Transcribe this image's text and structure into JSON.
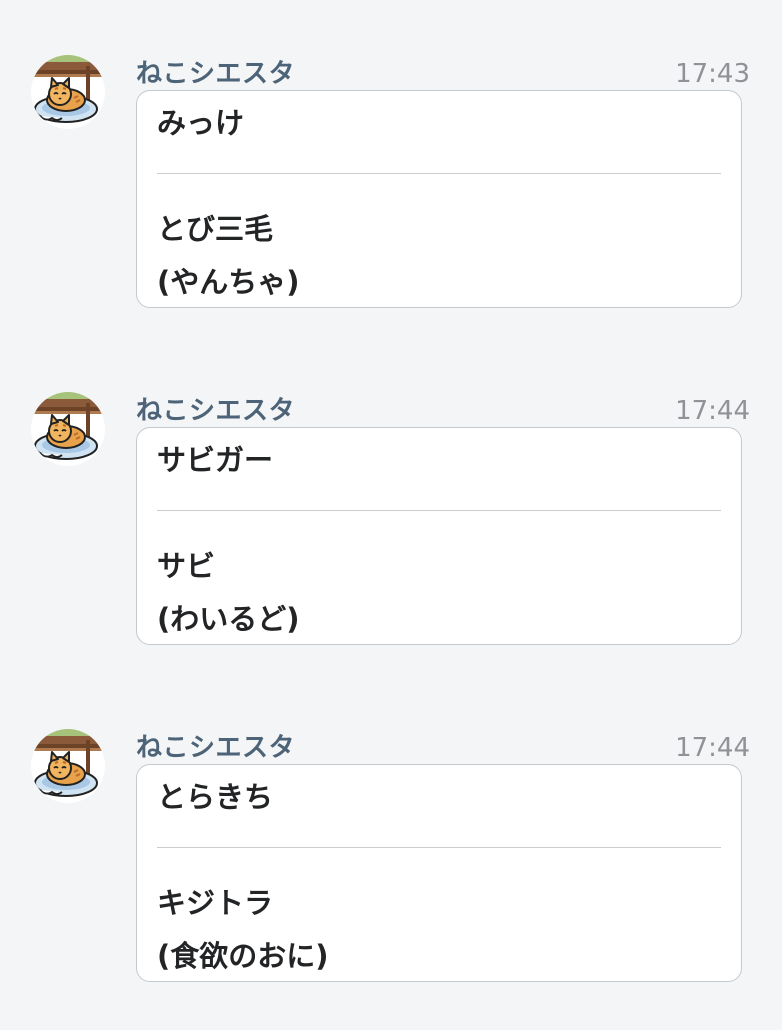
{
  "messages": [
    {
      "sender": "ねこシエスタ",
      "time": "17:43",
      "avatar": "cat-in-basket-avatar",
      "name": "みっけ",
      "breed": "とび三毛",
      "personality": "(やんちゃ)"
    },
    {
      "sender": "ねこシエスタ",
      "time": "17:44",
      "avatar": "cat-in-basket-avatar",
      "name": "サビガー",
      "breed": "サビ",
      "personality": "(わいるど)"
    },
    {
      "sender": "ねこシエスタ",
      "time": "17:44",
      "avatar": "cat-in-basket-avatar",
      "name": "とらきち",
      "breed": "キジトラ",
      "personality": "(食欲のおに)"
    }
  ],
  "colors": {
    "background": "#f4f5f7",
    "sender_name": "#4d6478",
    "timestamp": "#8f9297",
    "card_border": "#c6c9ce",
    "text": "#222426"
  }
}
